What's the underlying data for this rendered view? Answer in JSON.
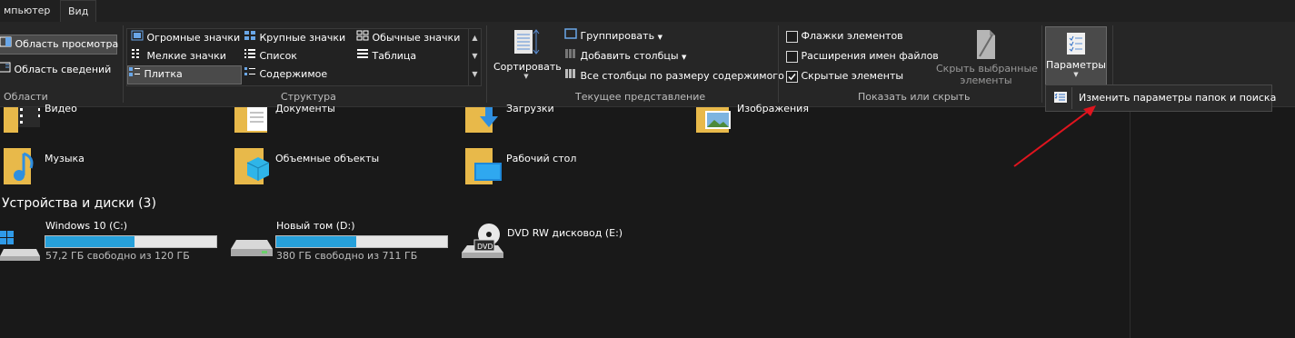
{
  "tabs": [
    {
      "label": "мпьютер"
    },
    {
      "label": "Вид"
    }
  ],
  "ribbon": {
    "areas": {
      "preview_pane": "Область просмотра",
      "details_pane": "Область сведений",
      "group_label": "Области"
    },
    "layout": {
      "items": [
        "Огромные значки",
        "Крупные значки",
        "Обычные значки",
        "Мелкие значки",
        "Список",
        "Таблица",
        "Плитка",
        "Содержимое"
      ],
      "selected": "Плитка",
      "group_label": "Структура"
    },
    "current_view": {
      "sort_label": "Сортировать",
      "group_by": "Группировать",
      "add_columns": "Добавить столбцы",
      "fit_columns": "Все столбцы по размеру содержимого",
      "group_label": "Текущее представление"
    },
    "show_hide": {
      "item_checkboxes": {
        "label": "Флажки элементов",
        "checked": false
      },
      "file_extensions": {
        "label": "Расширения имен файлов",
        "checked": false
      },
      "hidden_items": {
        "label": "Скрытые элементы",
        "checked": true
      },
      "hide_selected_line1": "Скрыть выбранные",
      "hide_selected_line2": "элементы",
      "group_label": "Показать или скрыть"
    },
    "options": {
      "label": "Параметры"
    }
  },
  "popup": {
    "label": "Изменить параметры папок и поиска"
  },
  "folders": [
    {
      "name": "Видео",
      "icon": "video-folder-icon"
    },
    {
      "name": "Документы",
      "icon": "documents-folder-icon"
    },
    {
      "name": "Загрузки",
      "icon": "downloads-folder-icon"
    },
    {
      "name": "Изображения",
      "icon": "pictures-folder-icon"
    },
    {
      "name": "Музыка",
      "icon": "music-folder-icon"
    },
    {
      "name": "Объемные объекты",
      "icon": "3d-objects-folder-icon"
    },
    {
      "name": "Рабочий стол",
      "icon": "desktop-folder-icon"
    }
  ],
  "devices": {
    "header": "Устройства и диски (3)",
    "drives": [
      {
        "name": "Windows 10 (C:)",
        "free_text": "57,2 ГБ свободно из 120 ГБ",
        "used_fraction": 0.52
      },
      {
        "name": "Новый том (D:)",
        "free_text": "380 ГБ свободно из 711 ГБ",
        "used_fraction": 0.47
      },
      {
        "name": "DVD RW дисковод (E:)",
        "icon": "dvd-drive-icon"
      }
    ]
  },
  "colors": {
    "background": "#191919",
    "ribbon": "#262626",
    "accent_bar": "#26a0da",
    "arrow": "#e0141e"
  }
}
